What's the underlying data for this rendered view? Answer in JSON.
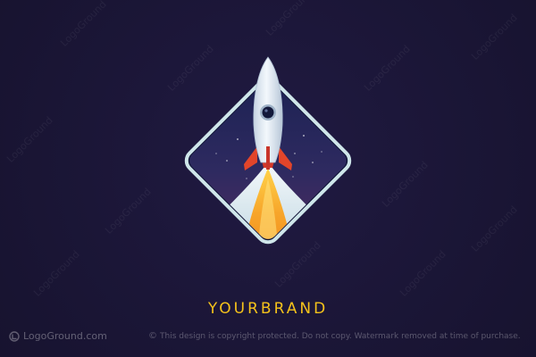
{
  "brand": {
    "name": "YOURBRAND",
    "color": "#f5c21b"
  },
  "colors": {
    "background": "#1b1637",
    "frame_border": "#cfe6ea",
    "sky_top": "#1e2452",
    "sky_bottom": "#4a2b5c",
    "flame_orange": "#f28a1e",
    "flame_yellow": "#f7c321",
    "rocket_body": "#dfe9f2",
    "rocket_fins": "#e2452a"
  },
  "watermark": {
    "repeat_text": "LogoGround",
    "site_name": "LogoGround.com",
    "notice": "This design is copyright protected. Do not copy. Watermark removed at time of purchase.",
    "copyright_symbol": "©"
  },
  "icons": {
    "site_logo": "logoground-logo-icon",
    "copyright": "copyright-icon"
  }
}
